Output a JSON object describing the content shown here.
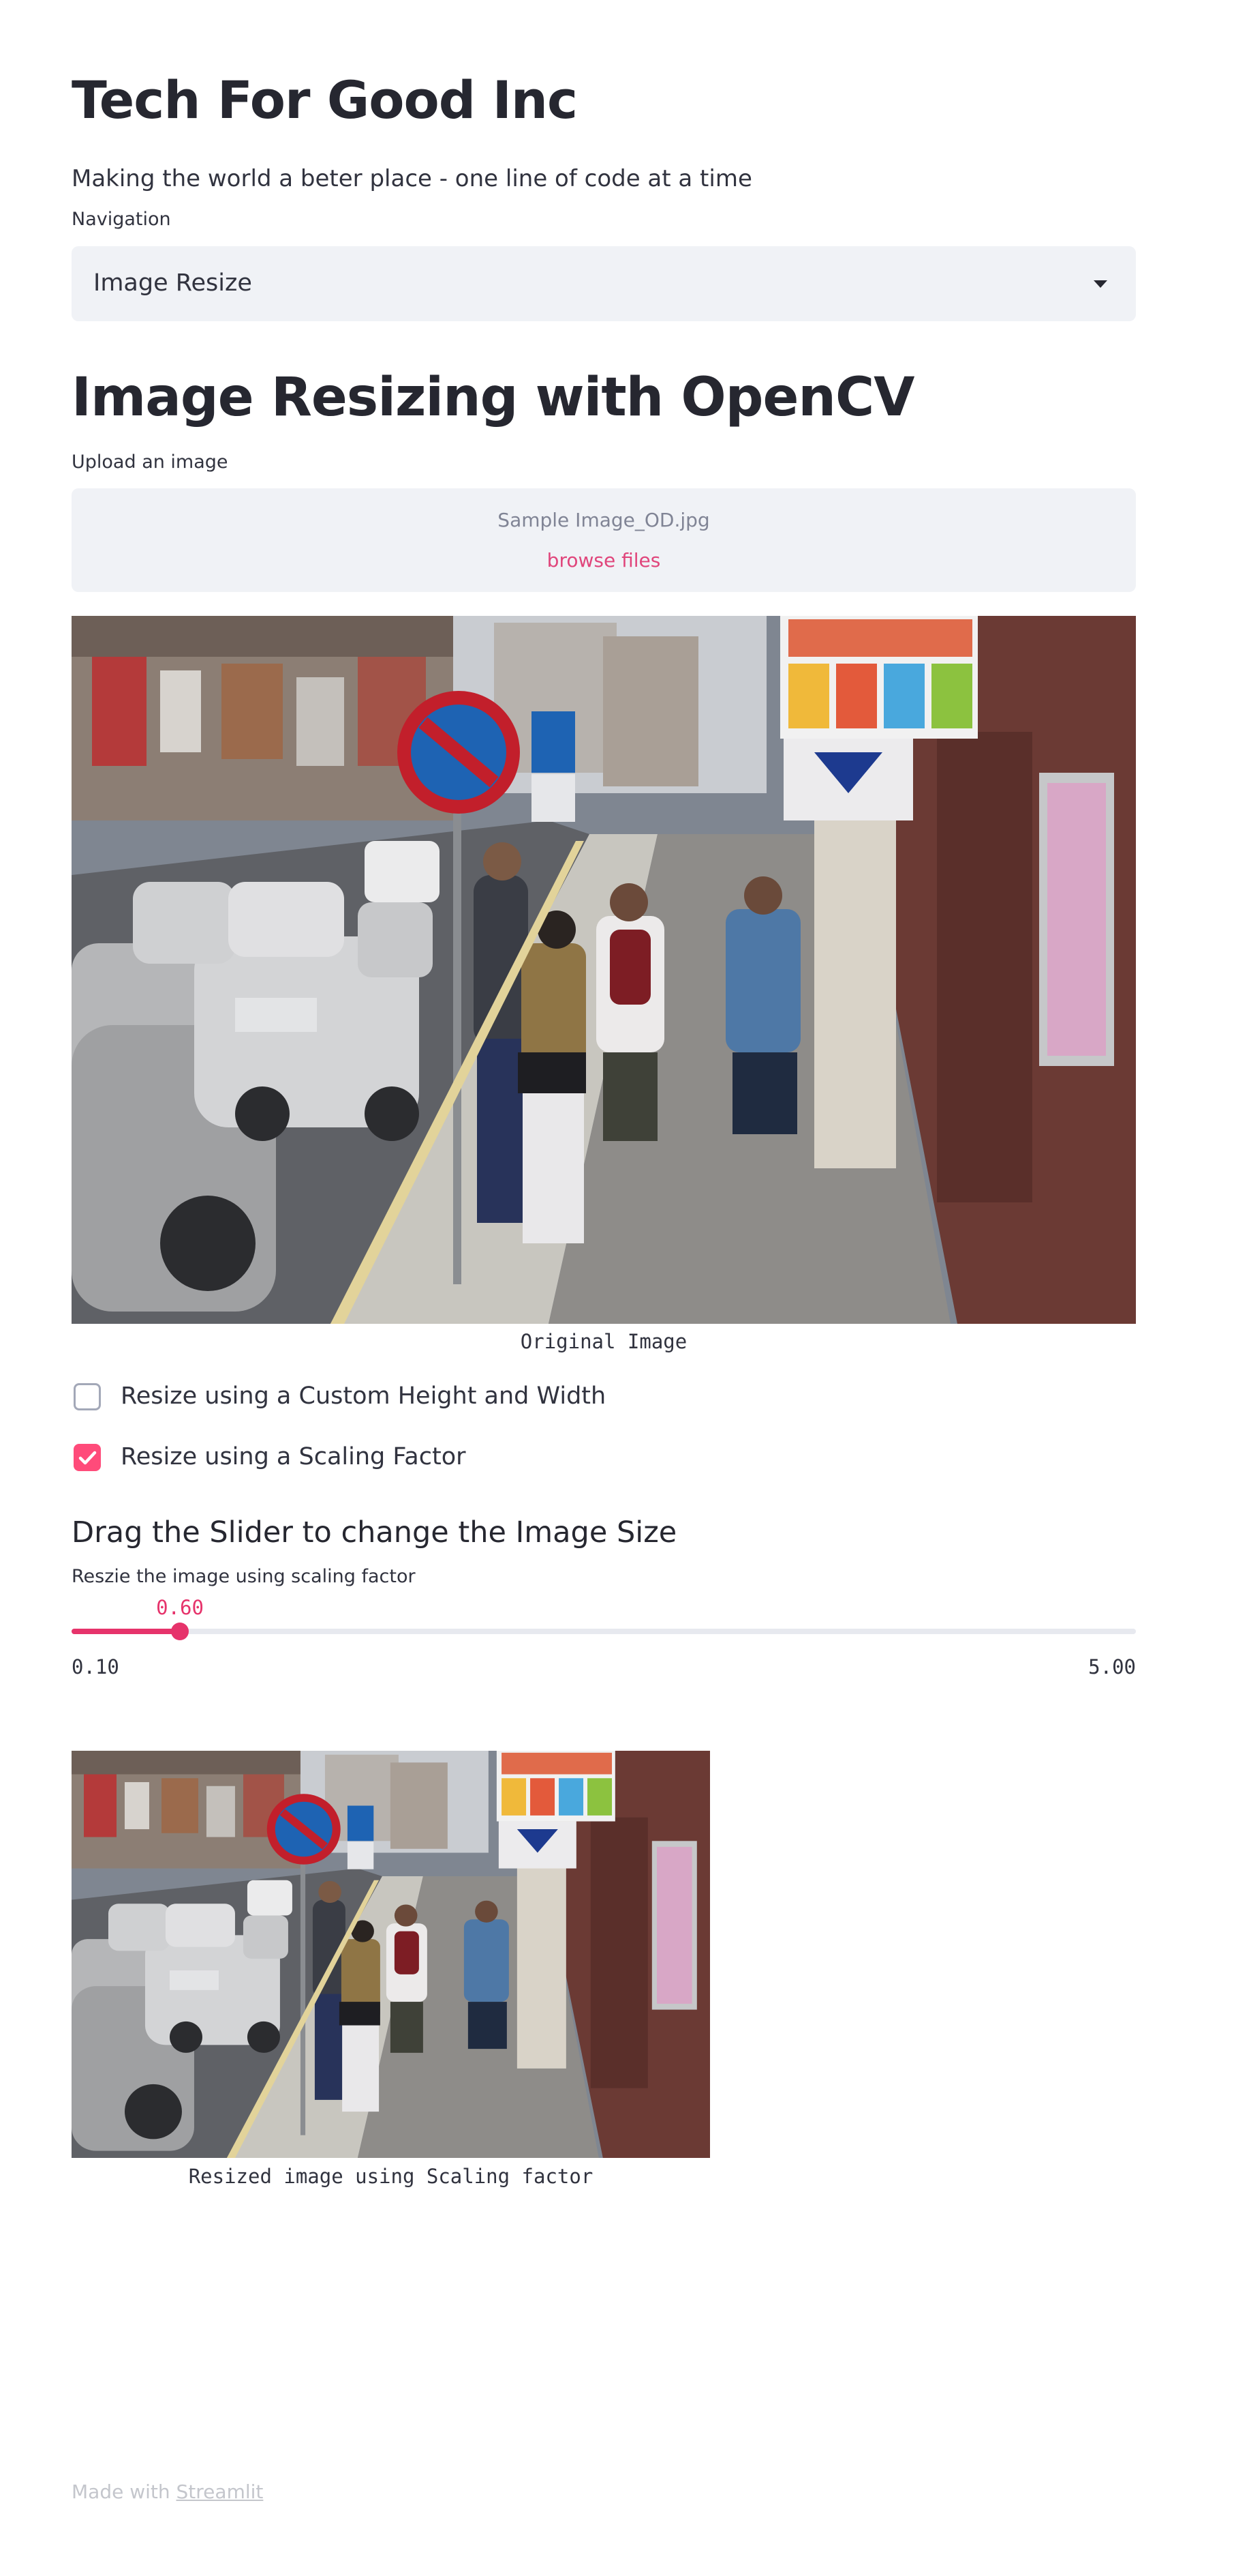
{
  "header": {
    "title": "Tech For Good Inc",
    "subtitle": "Making the world a beter place - one line of code at a time"
  },
  "navigation": {
    "label": "Navigation",
    "selected": "Image Resize",
    "icon": "chevron-down-icon"
  },
  "page": {
    "heading": "Image Resizing with OpenCV"
  },
  "uploader": {
    "label": "Upload an image",
    "file_name": "Sample Image_OD.jpg",
    "browse_label": "browse files"
  },
  "original_image": {
    "caption": "Original Image",
    "description": "Street scene"
  },
  "options": {
    "custom_size": {
      "label": "Resize using a Custom Height and Width",
      "checked": false
    },
    "scaling": {
      "label": "Resize using a Scaling Factor",
      "checked": true
    }
  },
  "slider_section": {
    "heading": "Drag the Slider to change the Image Size",
    "label": "Reszie the image using scaling factor",
    "value": 0.6,
    "value_text": "0.60",
    "min": 0.1,
    "min_text": "0.10",
    "max": 5.0,
    "max_text": "5.00"
  },
  "resized_image": {
    "caption": "Resized image using Scaling factor"
  },
  "footer": {
    "prefix": "Made with ",
    "link": "Streamlit"
  },
  "colors": {
    "accent": "#e6336b",
    "checkbox_on": "#ff4b7a",
    "input_bg": "#f0f2f6",
    "text": "#31333F"
  }
}
